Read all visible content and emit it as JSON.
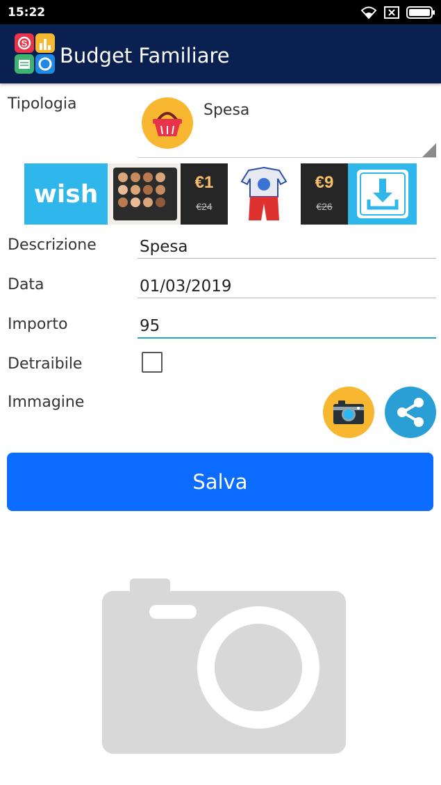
{
  "status_bar": {
    "time": "15:22",
    "icons": [
      "wifi-icon",
      "sim-x-icon",
      "battery-icon"
    ]
  },
  "app_bar": {
    "title": "Budget Familiare",
    "logo_icon": "budget-app-logo-icon"
  },
  "form": {
    "tipologia": {
      "label": "Tipologia",
      "value": "Spesa",
      "icon": "shopping-basket-icon"
    },
    "descrizione": {
      "label": "Descrizione",
      "value": "Spesa"
    },
    "data": {
      "label": "Data",
      "value": "01/03/2019"
    },
    "importo": {
      "label": "Importo",
      "value": "95"
    },
    "detraibile": {
      "label": "Detraibile",
      "checked": false
    },
    "immagine": {
      "label": "Immagine",
      "camera_icon": "camera-icon",
      "share_icon": "share-icon"
    }
  },
  "ad": {
    "brand": "wish",
    "offers": [
      {
        "price": "€1",
        "old_price": "€24"
      },
      {
        "price": "€9",
        "old_price": "€26"
      }
    ],
    "download_icon": "download-icon"
  },
  "save_button": {
    "label": "Salva"
  },
  "image_placeholder": {
    "icon": "camera-placeholder-icon"
  },
  "colors": {
    "app_bar": "#0a2050",
    "save_button": "#0b6cff",
    "accent_yellow": "#f7b731",
    "share_blue": "#2a9fd6",
    "active_field_underline": "#2a9fd6"
  }
}
